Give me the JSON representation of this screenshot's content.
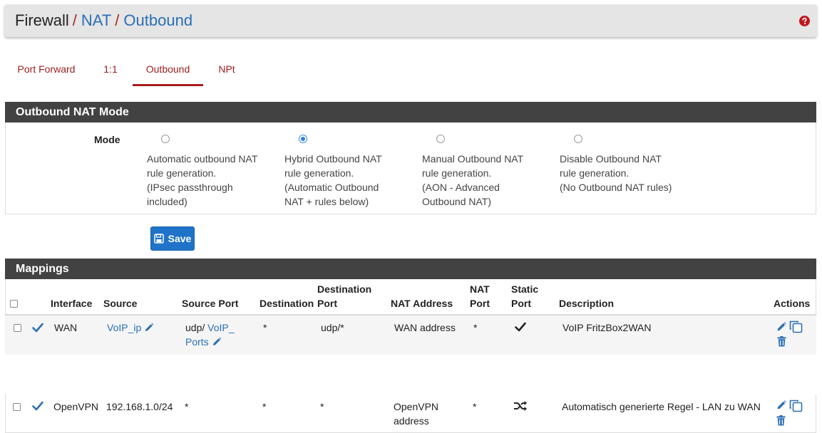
{
  "breadcrumb": {
    "items": [
      "Firewall",
      "NAT",
      "Outbound"
    ],
    "separator": "/"
  },
  "help_icon": "question-circle-icon",
  "tabs": [
    {
      "label": "Port Forward",
      "active": false
    },
    {
      "label": "1:1",
      "active": false
    },
    {
      "label": "Outbound",
      "active": true
    },
    {
      "label": "NPt",
      "active": false
    }
  ],
  "mode_panel": {
    "title": "Outbound NAT Mode",
    "label": "Mode",
    "options": [
      {
        "lines": [
          "Automatic outbound NAT",
          "rule generation.",
          "(IPsec passthrough",
          "included)"
        ],
        "checked": false
      },
      {
        "lines": [
          "Hybrid Outbound NAT",
          "rule generation.",
          "(Automatic Outbound",
          "NAT + rules below)"
        ],
        "checked": true
      },
      {
        "lines": [
          "Manual Outbound NAT",
          "rule generation.",
          "(AON - Advanced",
          "Outbound NAT)"
        ],
        "checked": false
      },
      {
        "lines": [
          "Disable Outbound NAT",
          "rule generation.",
          "(No Outbound NAT rules)"
        ],
        "checked": false
      }
    ]
  },
  "save_button": {
    "label": "Save",
    "icon": "save-disk-icon"
  },
  "mappings": {
    "title": "Mappings",
    "columns": {
      "interface": "Interface",
      "source": "Source",
      "source_port": "Source Port",
      "destination": "Destination",
      "destination_port": [
        "Destination",
        "Port"
      ],
      "nat_address": "NAT Address",
      "nat_port": [
        "NAT",
        "Port"
      ],
      "static_port": [
        "Static",
        "Port"
      ],
      "description": "Description",
      "actions": "Actions"
    },
    "rows": [
      {
        "interface": "WAN",
        "source": "VoIP_ip",
        "source_port_prefix": "udp/",
        "source_port_alias": [
          "VoIP_",
          "Ports"
        ],
        "destination": "*",
        "destination_port": "udp/*",
        "nat_address": "WAN address",
        "nat_port": "*",
        "static_port_icon": "checkmark-icon",
        "description": "VoIP FritzBox2WAN"
      },
      {
        "interface": "OpenVPN",
        "source": "192.168.1.0/24",
        "source_port": "*",
        "destination": "*",
        "destination_port": "*",
        "nat_address": [
          "OpenVPN",
          "address"
        ],
        "nat_port": "*",
        "static_port_icon": "shuffle-icon",
        "description": "Automatisch generierte Regel - LAN zu WAN"
      }
    ]
  },
  "colors": {
    "header_bg": "#e5e5e5",
    "link": "#2a6fb6",
    "tab": "#9b1c1c",
    "panel_head": "#424242",
    "button": "#1f73c9"
  }
}
